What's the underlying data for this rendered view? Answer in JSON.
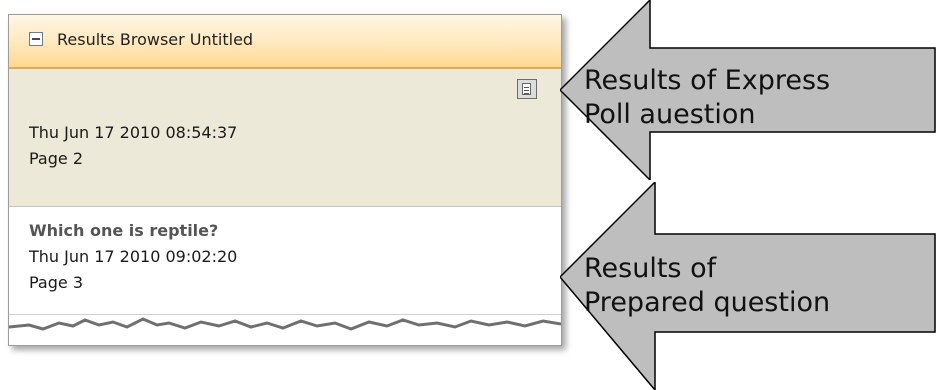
{
  "panel": {
    "title": "Results Browser Untitled",
    "items": [
      {
        "title": "",
        "date": "Thu Jun 17 2010 08:54:37",
        "page": "Page  2",
        "note_icon": "notes-icon"
      },
      {
        "title": "Which one is reptile?",
        "date": "Thu Jun 17 2010 09:02:20",
        "page": "Page  3"
      }
    ]
  },
  "callouts": [
    {
      "lines": [
        "Results of Express",
        "Poll auestion"
      ]
    },
    {
      "lines": [
        "Results of",
        "Prepared question"
      ]
    }
  ],
  "colors": {
    "header_accent": "#ffd98f",
    "selected_item_bg": "#ece9d8",
    "arrow_fill": "#bebebe"
  }
}
